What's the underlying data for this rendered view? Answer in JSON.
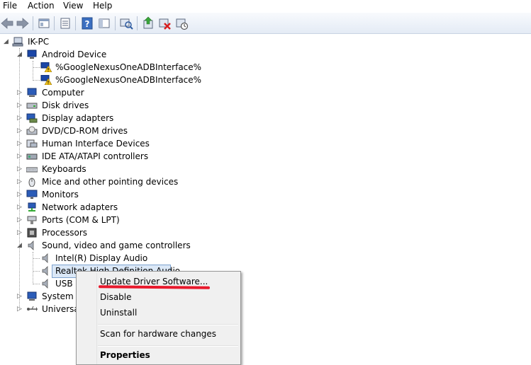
{
  "menubar": {
    "file": "File",
    "action": "Action",
    "view": "View",
    "help": "Help"
  },
  "toolbar": {
    "icons": [
      "back-icon",
      "forward-icon",
      "up-icon",
      "properties-icon",
      "help-icon",
      "show-hide-icon",
      "scan-icon",
      "update-driver-icon",
      "uninstall-icon",
      "disable-icon"
    ]
  },
  "tree": {
    "root": "IK-PC",
    "android": {
      "label": "Android Device",
      "children": [
        "%GoogleNexusOneADBInterface%",
        "%GoogleNexusOneADBInterface%"
      ]
    },
    "categories": [
      "Computer",
      "Disk drives",
      "Display adapters",
      "DVD/CD-ROM drives",
      "Human Interface Devices",
      "IDE ATA/ATAPI controllers",
      "Keyboards",
      "Mice and other pointing devices",
      "Monitors",
      "Network adapters",
      "Ports (COM & LPT)",
      "Processors"
    ],
    "sound": {
      "label": "Sound, video and game controllers",
      "children": [
        "Intel(R) Display Audio",
        "Realtek High Definition Audio",
        "USB P"
      ]
    },
    "system": "System d",
    "universal": "Universal"
  },
  "context_menu": {
    "update": "Update Driver Software...",
    "disable": "Disable",
    "uninstall": "Uninstall",
    "scan": "Scan for hardware changes",
    "properties": "Properties"
  },
  "colors": {
    "annotation": "#e8192c",
    "selection": "#dbe8f7",
    "toolbar": "#e4ebf5"
  }
}
